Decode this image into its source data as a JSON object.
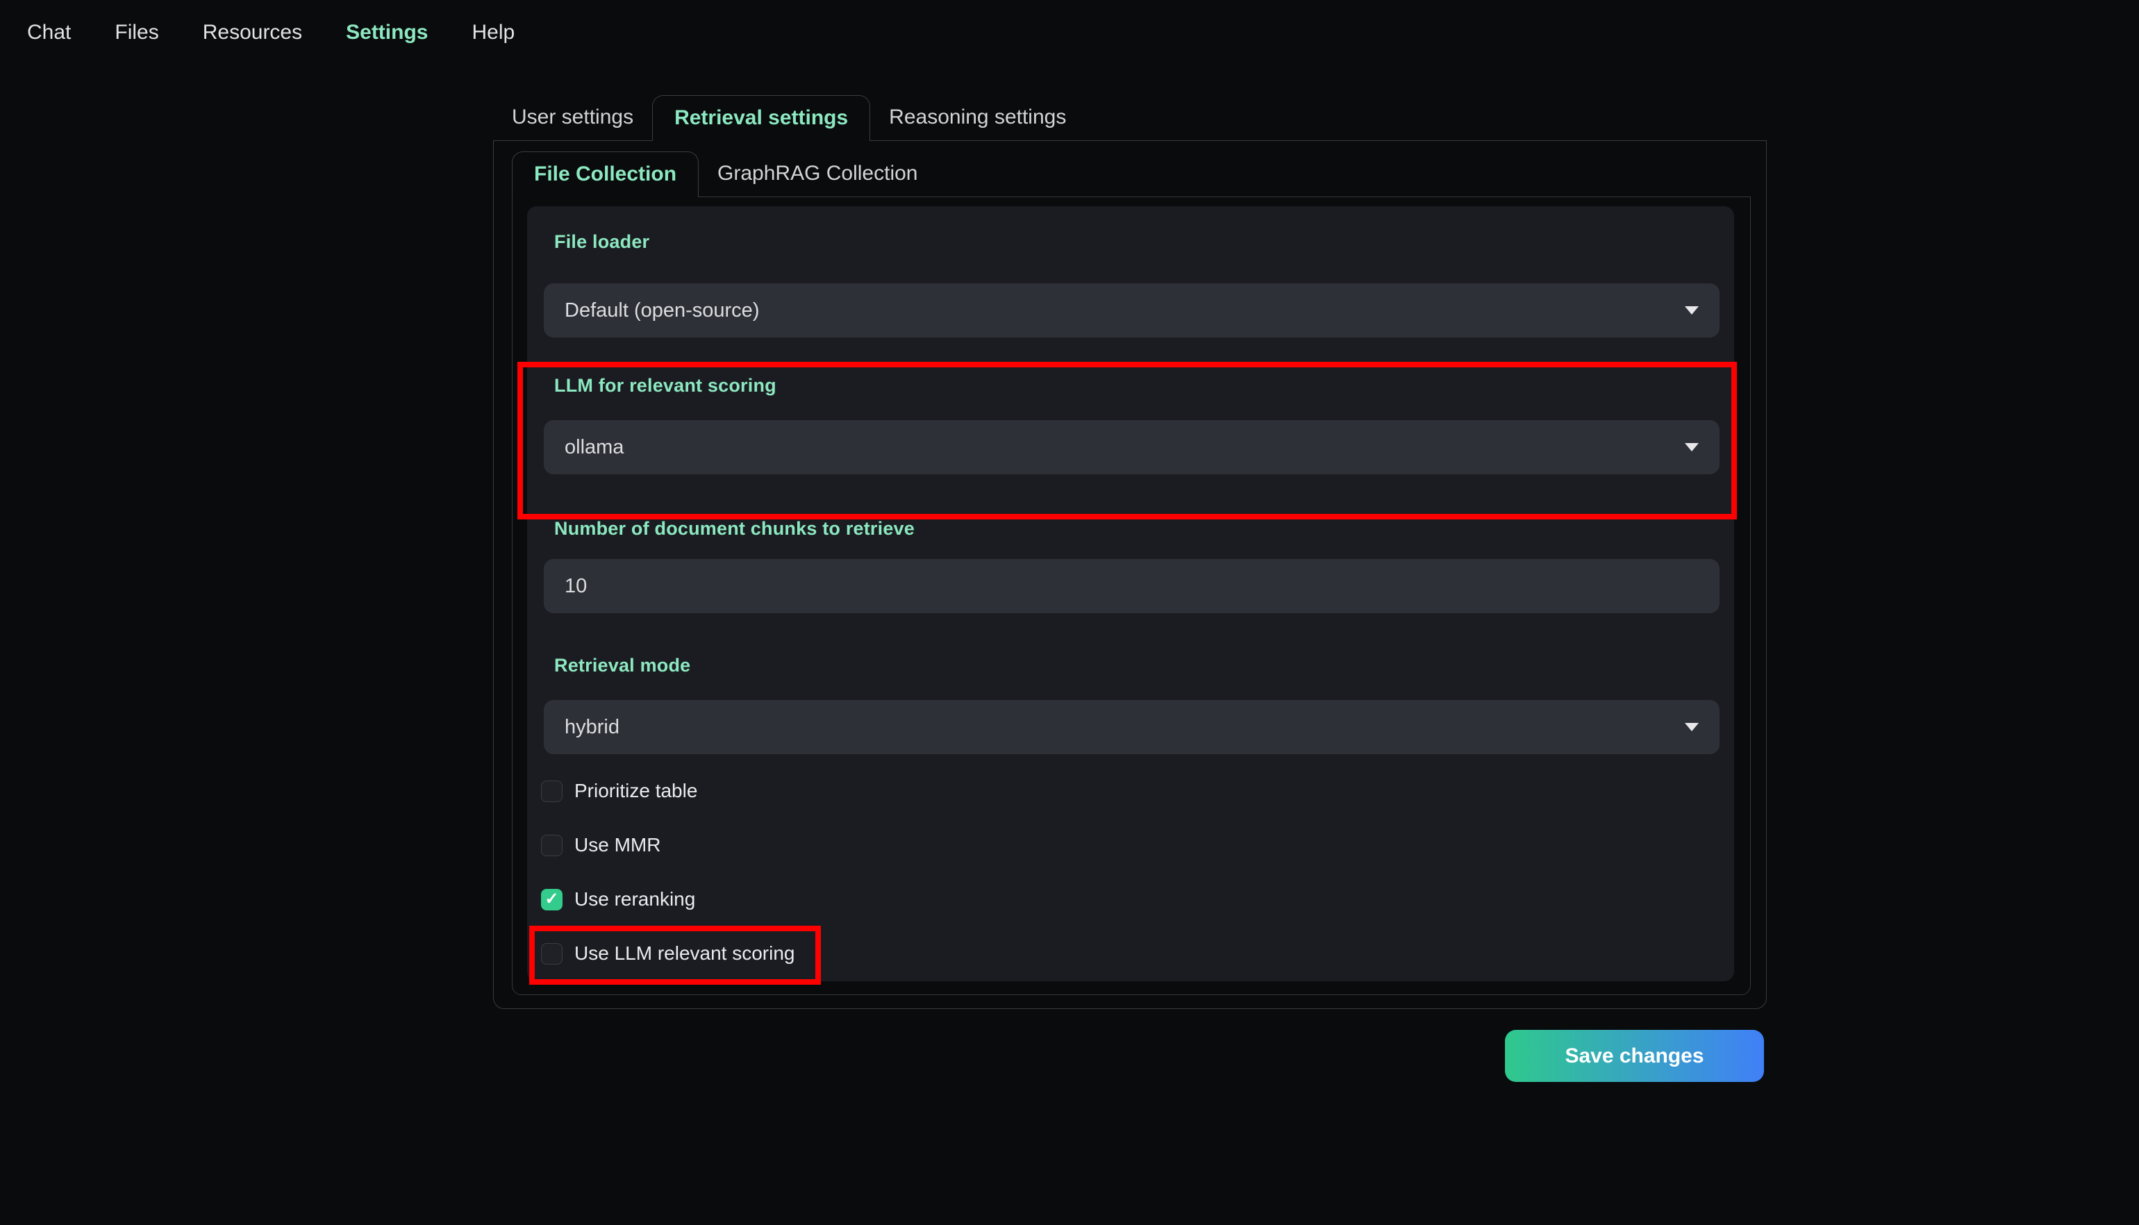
{
  "nav": {
    "items": [
      {
        "label": "Chat",
        "active": false
      },
      {
        "label": "Files",
        "active": false
      },
      {
        "label": "Resources",
        "active": false
      },
      {
        "label": "Settings",
        "active": true
      },
      {
        "label": "Help",
        "active": false
      }
    ]
  },
  "tabs": {
    "items": [
      "User settings",
      "Retrieval settings",
      "Reasoning settings"
    ],
    "active": "Retrieval settings"
  },
  "subtabs": {
    "items": [
      "File Collection",
      "GraphRAG Collection"
    ],
    "active": "File Collection"
  },
  "form": {
    "file_loader": {
      "label": "File loader",
      "value": "Default (open-source)"
    },
    "llm_scoring": {
      "label": "LLM for relevant scoring",
      "value": "ollama"
    },
    "num_chunks": {
      "label": "Number of document chunks to retrieve",
      "value": "10"
    },
    "retrieval_mode": {
      "label": "Retrieval mode",
      "value": "hybrid"
    },
    "checkboxes": [
      {
        "label": "Prioritize table",
        "checked": false
      },
      {
        "label": "Use MMR",
        "checked": false
      },
      {
        "label": "Use reranking",
        "checked": true
      },
      {
        "label": "Use LLM relevant scoring",
        "checked": false
      }
    ]
  },
  "save": {
    "label": "Save changes"
  },
  "icons": {
    "dropdown": "chevron-down-icon",
    "checked": "check-icon"
  },
  "colors": {
    "page_bg": "#0a0b0d",
    "card_bg": "#1b1c21",
    "control_bg": "#2e3038",
    "border": "#3a3c42",
    "accent_green": "#8ce8c0",
    "checkbox_checked": "#33cc8c",
    "save_gradient_start": "#2fc98c",
    "save_gradient_end": "#4080f8",
    "annotation_red": "#fe0000",
    "text_light": "#dededf"
  },
  "annotations": [
    {
      "target": "LLM for relevant scoring section"
    },
    {
      "target": "Use LLM relevant scoring checkbox"
    }
  ]
}
